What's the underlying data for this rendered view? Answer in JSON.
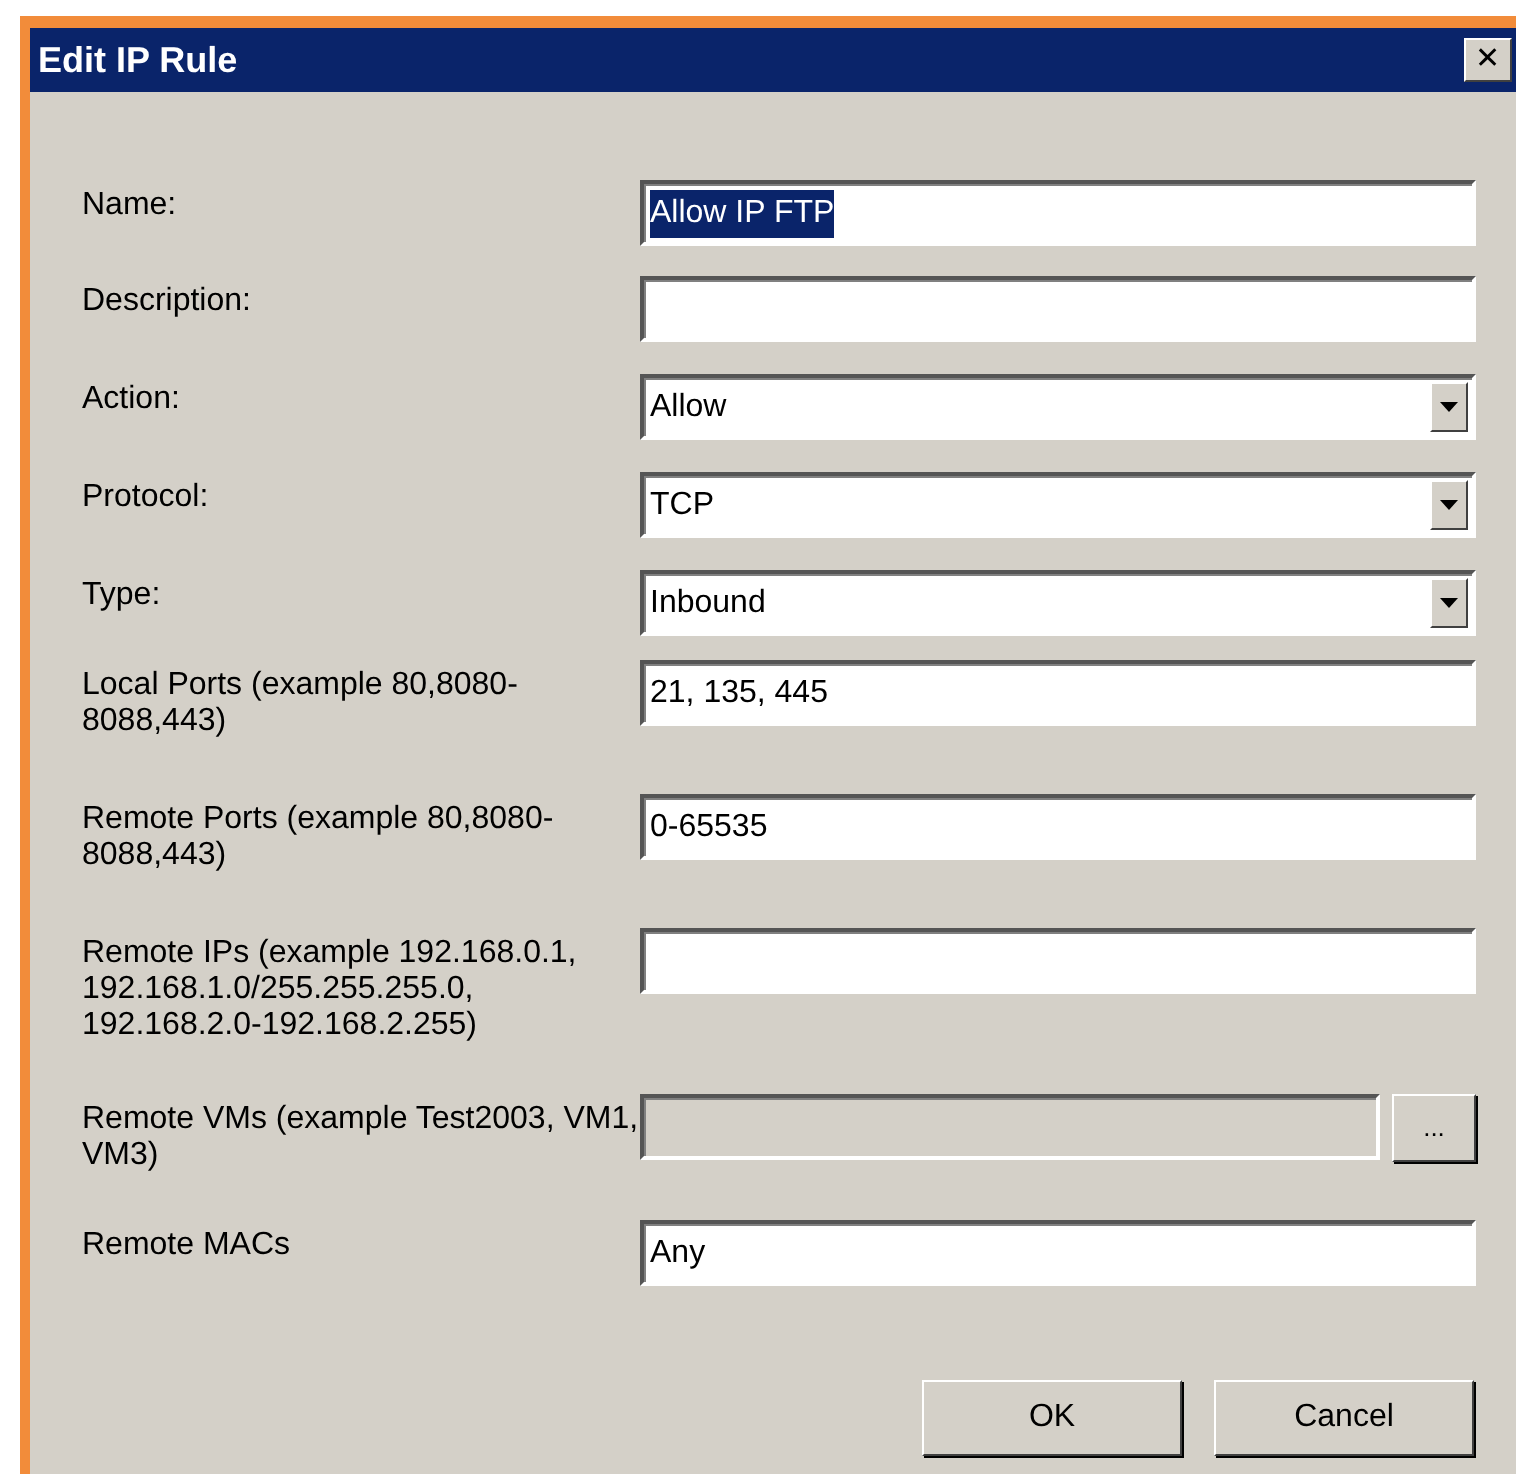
{
  "window": {
    "title": "Edit IP Rule",
    "close": "✕"
  },
  "fields": [
    {
      "kind": "text",
      "label": "Name:",
      "value": "Allow IP FTP",
      "selected": true
    },
    {
      "kind": "text",
      "label": "Description:"
    },
    {
      "kind": "select",
      "label": "Action:",
      "value": "Allow"
    },
    {
      "kind": "select",
      "label": "Protocol:",
      "value": "TCP"
    },
    {
      "kind": "select",
      "label": "Type:",
      "value": "Inbound"
    },
    {
      "kind": "text",
      "label": "Local Ports (example 80,8080-8088,443)",
      "value": "21, 135, 445",
      "selected": false
    },
    {
      "kind": "text",
      "label": "Remote Ports (example 80,8080-8088,443)",
      "value": "0-65535",
      "selected": false
    },
    {
      "kind": "text",
      "label": "Remote IPs (example 192.168.0.1, 192.168.1.0/255.255.255.0, 192.168.2.0-192.168.2.255)"
    },
    {
      "kind": "browse",
      "label": "Remote VMs (example Test2003, VM1, VM3)",
      "button": "...",
      "disabled": true
    },
    {
      "kind": "text",
      "label": "Remote MACs",
      "value": "Any",
      "selected": false
    }
  ],
  "buttons": [
    "OK",
    "Cancel"
  ]
}
